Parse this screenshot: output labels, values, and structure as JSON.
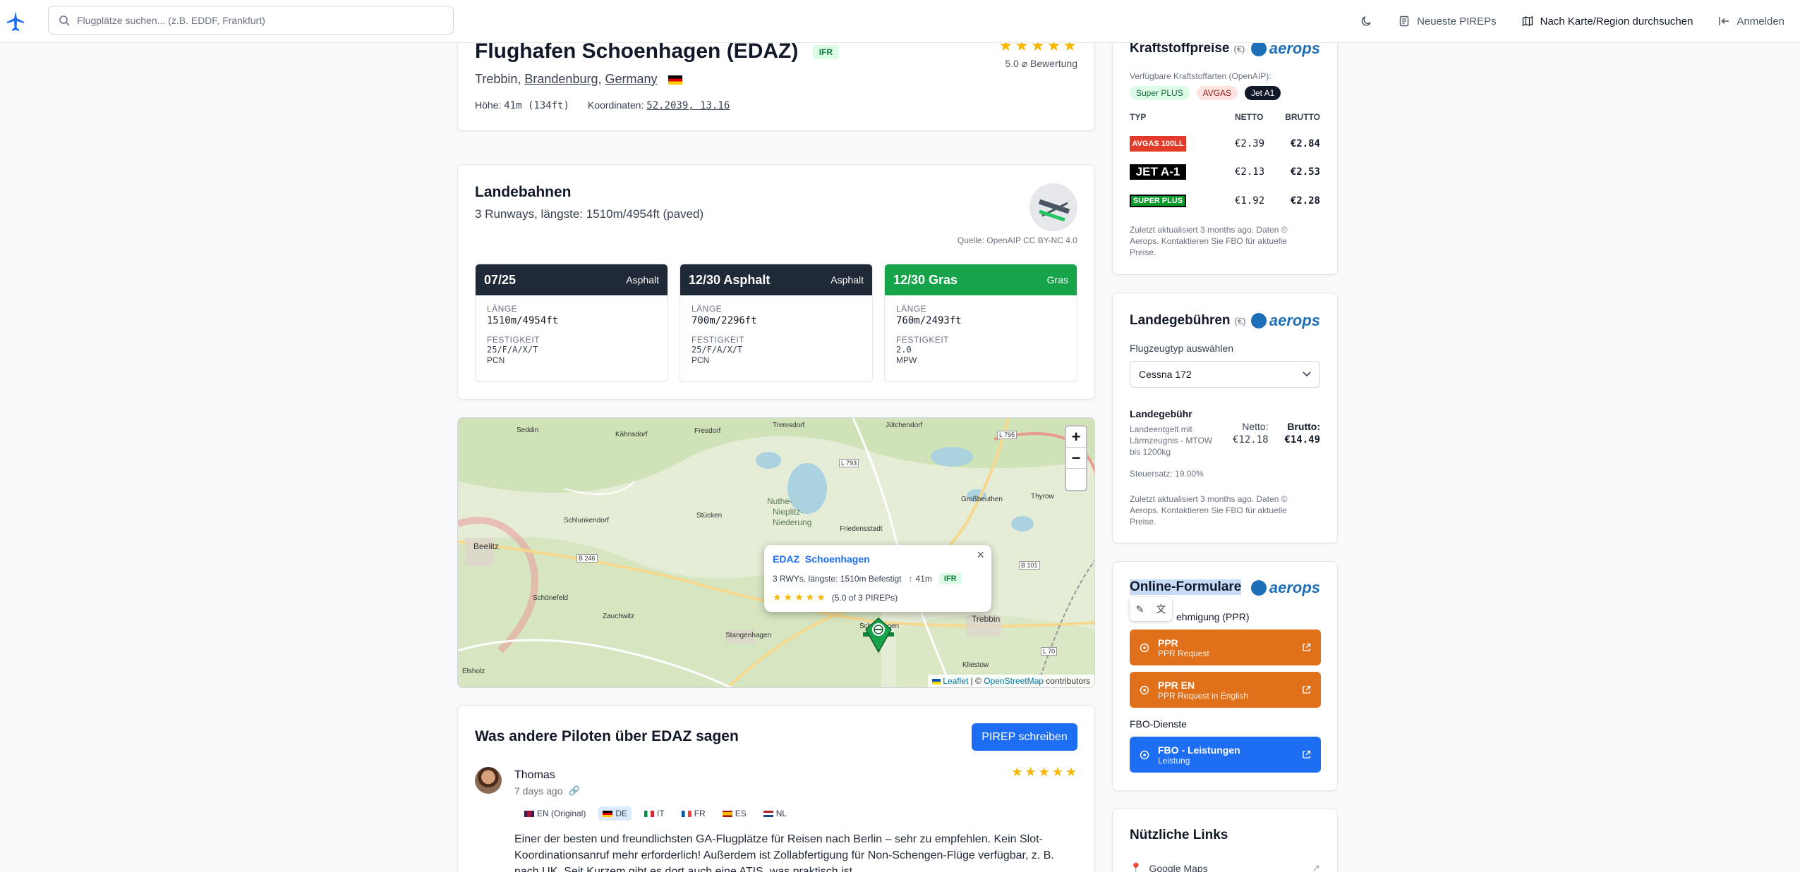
{
  "topbar": {
    "search_placeholder": "Flugplätze suchen... (z.B. EDDF, Frankfurt)",
    "nav_pireps": "Neueste PIREPs",
    "nav_map": "Nach Karte/Region durchsuchen",
    "nav_login": "Anmelden"
  },
  "airport": {
    "name": "Flughafen Schoenhagen (EDAZ)",
    "badge": "IFR",
    "city": "Trebbin,",
    "state": "Brandenburg",
    "country": "Germany",
    "elevation_label": "Höhe:",
    "elevation_value": "41m (134ft)",
    "coords_label": "Koordinaten:",
    "coords_value": "52.2039, 13.16",
    "stars": "★★★★★",
    "rating": "5.0 ⌀ Bewertung"
  },
  "runways": {
    "title": "Landebahnen",
    "summary": "3 Runways, längste: 1510m/4954ft (paved)",
    "source": "Quelle: OpenAIP CC BY-NC 4.0",
    "length_label": "Länge",
    "strength_label": "Festigkeit",
    "items": [
      {
        "name": "07/25",
        "surface": "Asphalt",
        "length": "1510m/4954ft",
        "strength": "25/F/A/X/T",
        "unit": "PCN",
        "color": "#1f2937"
      },
      {
        "name": "12/30 Asphalt",
        "surface": "Asphalt",
        "length": "700m/2296ft",
        "strength": "25/F/A/X/T",
        "unit": "PCN",
        "color": "#1f2937"
      },
      {
        "name": "12/30 Gras",
        "surface": "Gras",
        "length": "760m/2493ft",
        "strength": "2.0",
        "unit": "MPW",
        "color": "#16a34a"
      }
    ]
  },
  "map": {
    "zoom_in": "+",
    "zoom_out": "−",
    "labels": [
      "Seddin",
      "Kähnsdorf",
      "Fresdorf",
      "Tremsdorf",
      "Jütchendorf",
      "L 795",
      "L 793",
      "Nuthe-",
      "Nieplitz-",
      "Niederung",
      "Großbeuthen",
      "Thyrow",
      "Schlunkendorf",
      "Stücken",
      "Friedensstadt",
      "Beelitz",
      "B 246",
      "B 101",
      "Schönefeld",
      "Zauchwitz",
      "Stangenhagen",
      "Schönhagen",
      "Trebbin",
      "Elsholz",
      "Kliestow",
      "L 70"
    ],
    "popup_icao": "EDAZ",
    "popup_name": "Schoenhagen",
    "popup_info": "3 RWYs, längste: 1510m Befestigt",
    "popup_elev": "41m",
    "popup_badge": "IFR",
    "popup_stars": "★★★★★",
    "popup_rating": "(5.0 of 3 PIREPs)",
    "popup_close": "×",
    "attrib_leaflet": "Leaflet",
    "attrib_sep": " | © ",
    "attrib_osm": "OpenStreetMap",
    "attrib_rest": " contributors"
  },
  "pireps": {
    "title": "Was andere Piloten über EDAZ sagen",
    "button": "PIREP schreiben",
    "author": "Thomas",
    "time": "7 days ago",
    "stars": "★★★★★",
    "languages": [
      {
        "code": "EN (Original)",
        "active": false
      },
      {
        "code": "DE",
        "active": true
      },
      {
        "code": "IT",
        "active": false
      },
      {
        "code": "FR",
        "active": false
      },
      {
        "code": "ES",
        "active": false
      },
      {
        "code": "NL",
        "active": false
      }
    ],
    "text_line1": "Einer der besten und freundlichsten GA-Flugplätze für Reisen nach Berlin – sehr zu empfehlen. Kein Slot-",
    "text_line2": "Koordinationsanruf mehr erforderlich! Außerdem ist Zollabfertigung für Non-Schengen-Flüge verfügbar, z. B.",
    "text_line3": "nach UK. Seit Kurzem gibt es dort auch eine ATIS, was praktisch ist."
  },
  "fuel": {
    "title": "Kraftstoffpreise",
    "currency": "(€)",
    "brand": "aerops",
    "available_label": "Verfügbare Kraftstoffarten (OpenAIP):",
    "chips": [
      "Super PLUS",
      "AVGAS",
      "Jet A1"
    ],
    "col_type": "TYP",
    "col_net": "NETTO",
    "col_gross": "BRUTTO",
    "rows": [
      {
        "logo": "AVGAS 100LL",
        "net": "€2.39",
        "gross": "€2.84"
      },
      {
        "logo": "JET A-1",
        "net": "€2.13",
        "gross": "€2.53"
      },
      {
        "logo": "SUPER PLUS",
        "net": "€1.92",
        "gross": "€2.28"
      }
    ],
    "note": "Zuletzt aktualisiert 3 months ago. Daten © Aerops. Kontaktieren Sie FBO für aktuelle Preise."
  },
  "fees": {
    "title": "Landegebühren",
    "currency": "(€)",
    "brand": "aerops",
    "select_label": "Flugzeugtyp auswählen",
    "select_value": "Cessna 172",
    "fee_label": "Landegebühr",
    "fee_desc": "Landeentgelt mit Lärmzeugnis - MTOW bis 1200kg",
    "net_label": "Netto:",
    "net_value": "€12.18",
    "gross_label": "Brutto:",
    "gross_value": "€14.49",
    "tax": "Steuersatz: 19.00%",
    "note": "Zuletzt aktualisiert 3 months ago. Daten © Aerops. Kontaktieren Sie FBO für aktuelle Preise."
  },
  "forms": {
    "title": "Online-Formulare",
    "brand": "aerops",
    "ppr_label": "Vorabgenehmigung (PPR)",
    "ppr_visible": "ehmigung (PPR)",
    "fbo_label": "FBO-Dienste",
    "buttons": [
      {
        "title": "PPR",
        "sub": "PPR Request",
        "color": "#e0701a"
      },
      {
        "title": "PPR EN",
        "sub": "PPR Request in English",
        "color": "#e0701a"
      },
      {
        "title": "FBO - Leistungen",
        "sub": "Leistung",
        "color": "#1d6ef2"
      }
    ]
  },
  "links": {
    "title": "Nützliche Links",
    "google_maps": "Google Maps"
  }
}
